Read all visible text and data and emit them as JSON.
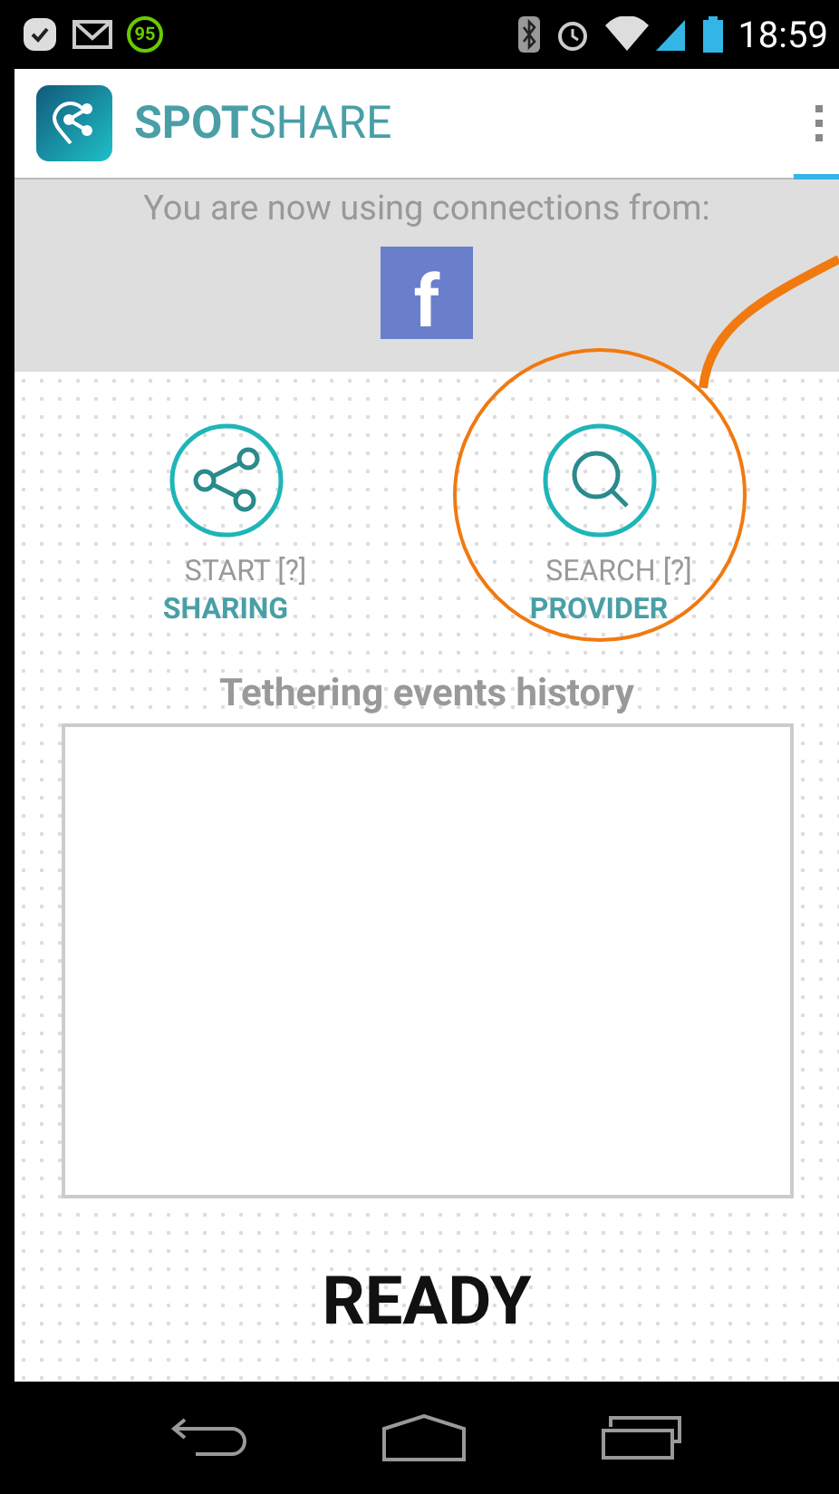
{
  "status_bar": {
    "battery_badge": "95",
    "time": "18:59"
  },
  "app_bar": {
    "title": "**SPOT**SHARE"
  },
  "connections": {
    "label": "You are now using connections from:",
    "sources": [
      {
        "glyph": "f",
        "color": "#6a7fcb"
      }
    ]
  },
  "actions": [
    {
      "kind": "share",
      "line1": "START [?]",
      "line2": "SHARING",
      "highlighted": false
    },
    {
      "kind": "search",
      "line1": "SEARCH [?]",
      "line2": "PROVIDER",
      "highlighted": true
    }
  ],
  "history": {
    "title": "Tethering events history"
  },
  "status": "READY"
}
